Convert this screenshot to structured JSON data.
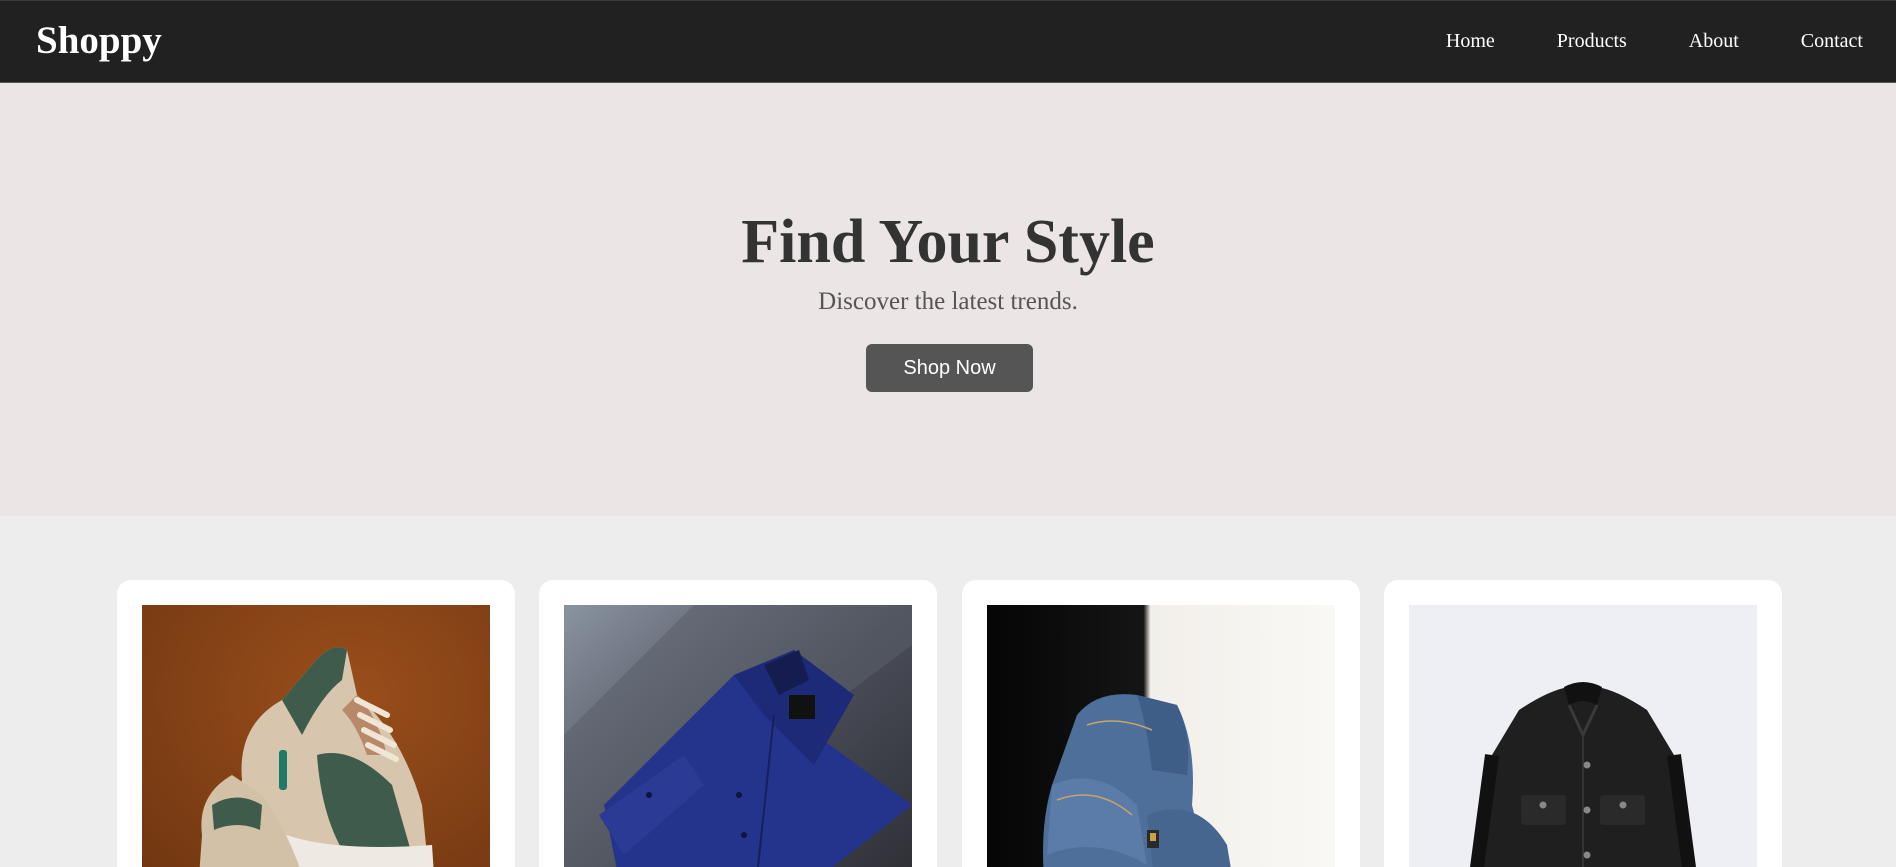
{
  "navbar": {
    "brand": "Shoppy",
    "links": [
      "Home",
      "Products",
      "About",
      "Contact"
    ]
  },
  "hero": {
    "title": "Find Your Style",
    "subtitle": "Discover the latest trends.",
    "button_label": "Shop Now"
  },
  "products": [
    {
      "image": "sneakers-photo"
    },
    {
      "image": "blue-dress-shirt-photo"
    },
    {
      "image": "denim-jeans-photo"
    },
    {
      "image": "black-denim-jacket-photo"
    }
  ],
  "colors": {
    "navbar_bg": "#212121",
    "hero_bg": "#ebe5e5",
    "page_bg": "#ededed",
    "button_bg": "#555555",
    "title_text": "#333333"
  }
}
